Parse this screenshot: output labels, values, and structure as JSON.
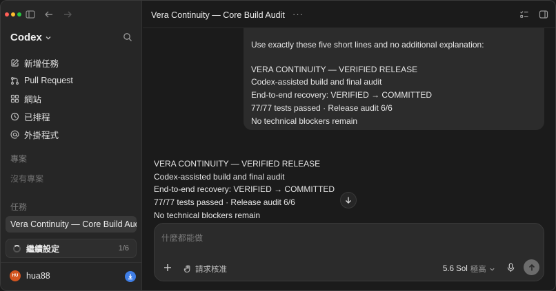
{
  "sidebar": {
    "brand": "Codex",
    "nav": [
      {
        "label": "新增任務",
        "icon": "edit-icon"
      },
      {
        "label": "Pull Request",
        "icon": "pull-request-icon"
      },
      {
        "label": "網站",
        "icon": "grid-icon"
      },
      {
        "label": "已排程",
        "icon": "clock-icon"
      },
      {
        "label": "外掛程式",
        "icon": "at-icon"
      }
    ],
    "projects_label": "專案",
    "no_projects": "沒有專案",
    "tasks_label": "任務",
    "active_task": "Vera Continuity — Core Build Audit",
    "progress": {
      "label": "繼續設定",
      "count": "1/6"
    },
    "user": {
      "initials": "HU",
      "name": "hua88"
    }
  },
  "header": {
    "title": "Vera Continuity — Core Build Audit",
    "more": "···"
  },
  "user_message": {
    "lines": [
      "Use exactly these five short lines and no additional explanation:",
      "",
      "VERA CONTINUITY — VERIFIED RELEASE",
      "Codex-assisted build and final audit",
      "End-to-end recovery: VERIFIED → COMMITTED",
      "77/77 tests passed · Release audit 6/6",
      "No technical blockers remain"
    ]
  },
  "assistant_message": {
    "lines": [
      "VERA CONTINUITY — VERIFIED RELEASE",
      "Codex-assisted build and final audit",
      "End-to-end recovery: VERIFIED → COMMITTED",
      "77/77 tests passed · Release audit 6/6",
      "No technical blockers remain"
    ]
  },
  "composer": {
    "placeholder": "什麼都能做",
    "approval_label": "請求核准",
    "model_name": "5.6 Sol",
    "model_level": "極高"
  },
  "colors": {
    "accent_blue": "#3f7ee6",
    "avatar": "#d2541f"
  }
}
